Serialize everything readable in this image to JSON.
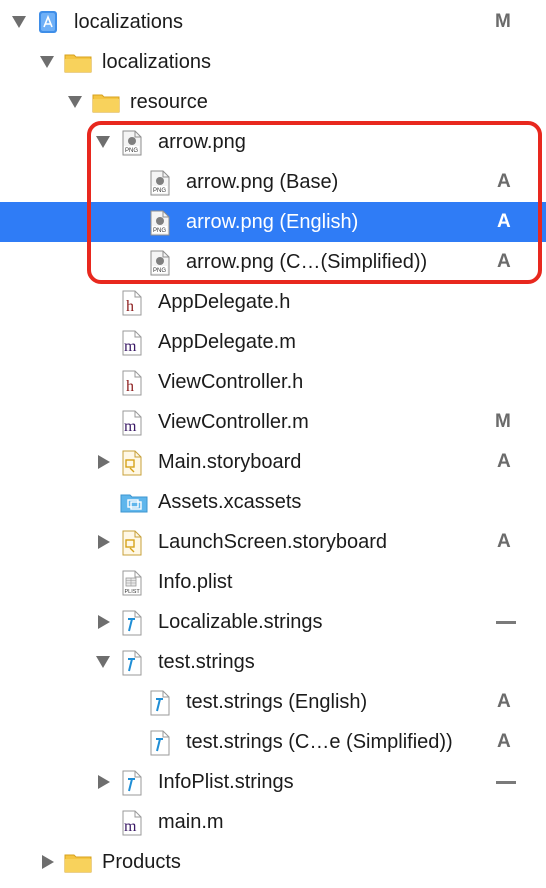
{
  "navigator": {
    "rows": [
      {
        "name": "project-localizations",
        "label": "localizations",
        "status": "M",
        "icon": "xcode-project-icon",
        "disclosure": "expanded"
      },
      {
        "name": "group-localizations",
        "label": "localizations",
        "status": "",
        "icon": "folder-icon",
        "disclosure": "expanded"
      },
      {
        "name": "group-resource",
        "label": "resource",
        "status": "",
        "icon": "folder-icon",
        "disclosure": "expanded"
      },
      {
        "name": "file-arrow-png",
        "label": "arrow.png",
        "status": "",
        "icon": "png-file-icon",
        "disclosure": "expanded"
      },
      {
        "name": "file-arrow-png-base",
        "label": "arrow.png (Base)",
        "status": "A",
        "icon": "png-file-icon",
        "disclosure": "none"
      },
      {
        "name": "file-arrow-png-english",
        "label": "arrow.png (English)",
        "status": "A",
        "icon": "png-file-icon",
        "disclosure": "none",
        "selected": true
      },
      {
        "name": "file-arrow-png-chinese",
        "label": "arrow.png (C…(Simplified))",
        "status": "A",
        "icon": "png-file-icon",
        "disclosure": "none"
      },
      {
        "name": "file-appdelegate-h",
        "label": "AppDelegate.h",
        "status": "",
        "icon": "header-file-icon",
        "disclosure": "none"
      },
      {
        "name": "file-appdelegate-m",
        "label": "AppDelegate.m",
        "status": "",
        "icon": "objc-file-icon",
        "disclosure": "none"
      },
      {
        "name": "file-viewcontroller-h",
        "label": "ViewController.h",
        "status": "",
        "icon": "header-file-icon",
        "disclosure": "none"
      },
      {
        "name": "file-viewcontroller-m",
        "label": "ViewController.m",
        "status": "M",
        "icon": "objc-file-icon",
        "disclosure": "none"
      },
      {
        "name": "file-main-storyboard",
        "label": "Main.storyboard",
        "status": "A",
        "icon": "storyboard-file-icon",
        "disclosure": "collapsed"
      },
      {
        "name": "file-assets-xcassets",
        "label": "Assets.xcassets",
        "status": "",
        "icon": "asset-catalog-icon",
        "disclosure": "none"
      },
      {
        "name": "file-launchscreen-storyboard",
        "label": "LaunchScreen.storyboard",
        "status": "A",
        "icon": "storyboard-file-icon",
        "disclosure": "collapsed"
      },
      {
        "name": "file-info-plist",
        "label": "Info.plist",
        "status": "",
        "icon": "plist-file-icon",
        "disclosure": "none"
      },
      {
        "name": "file-localizable-strings",
        "label": "Localizable.strings",
        "status": "—",
        "icon": "strings-file-icon",
        "disclosure": "collapsed"
      },
      {
        "name": "file-test-strings",
        "label": "test.strings",
        "status": "",
        "icon": "strings-file-icon",
        "disclosure": "expanded"
      },
      {
        "name": "file-test-strings-english",
        "label": "test.strings (English)",
        "status": "A",
        "icon": "strings-file-icon",
        "disclosure": "none"
      },
      {
        "name": "file-test-strings-chinese",
        "label": "test.strings (C…e (Simplified))",
        "status": "A",
        "icon": "strings-file-icon",
        "disclosure": "none"
      },
      {
        "name": "file-infoplist-strings",
        "label": "InfoPlist.strings",
        "status": "—",
        "icon": "strings-file-icon",
        "disclosure": "collapsed"
      },
      {
        "name": "file-main-m",
        "label": "main.m",
        "status": "",
        "icon": "objc-file-icon",
        "disclosure": "none"
      },
      {
        "name": "group-products",
        "label": "Products",
        "status": "",
        "icon": "folder-icon",
        "disclosure": "collapsed"
      }
    ]
  },
  "colors": {
    "selection": "#2f7cf6",
    "highlight_box": "#e8281e",
    "folder": "#f5c542",
    "header_glyph": "#8b1a1a",
    "objc_glyph": "#3b1a66",
    "strings_glyph": "#1f8ed6"
  }
}
